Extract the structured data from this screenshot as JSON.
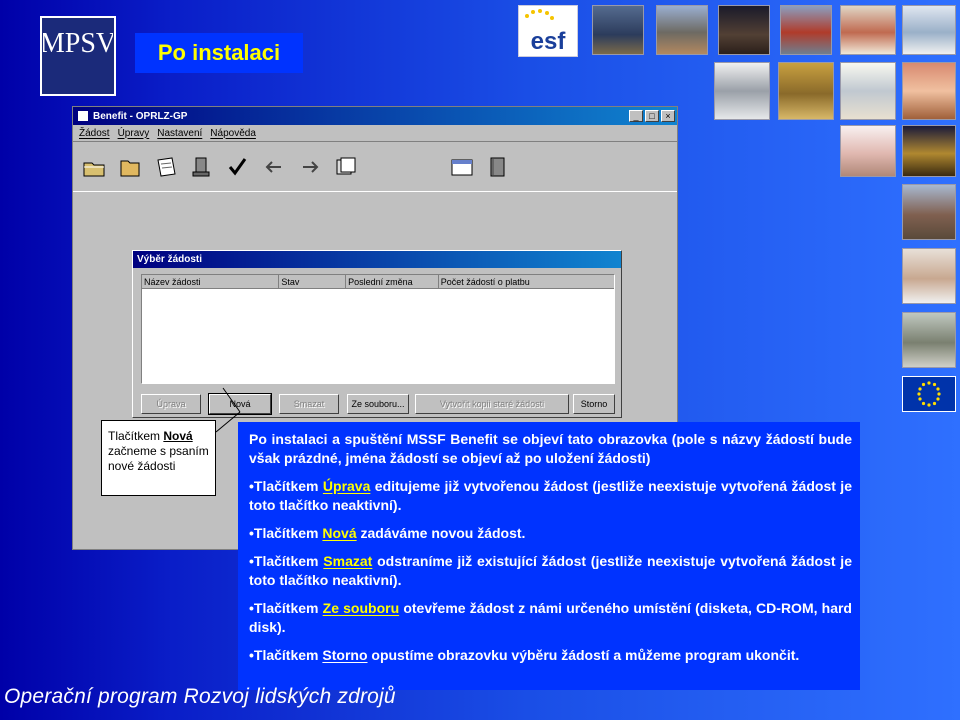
{
  "slide": {
    "title": "Po instalaci",
    "logo_text": "MPSV",
    "esf_text": "esf",
    "footer": "Operační program Rozvoj lidských zdrojů"
  },
  "colors": {
    "title_text": "#ffff00",
    "panel_bg": "#0033ff",
    "window_titlebar": "#000080"
  },
  "app": {
    "window_title": "Benefit - OPRLZ-GP",
    "menu": [
      "Žádost",
      "Úpravy",
      "Nastavení",
      "Nápověda"
    ],
    "toolbar_icons": [
      "folder-open-icon",
      "folder-icon",
      "document-icon",
      "stamp-icon",
      "check-icon",
      "arrow-left-icon",
      "arrow-right-icon",
      "cards-icon",
      "calendar-icon",
      "book-icon"
    ],
    "dialog": {
      "title": "Výběr žádosti",
      "columns": [
        "Název žádosti",
        "Stav",
        "Poslední změna",
        "Počet žádostí o platbu"
      ],
      "buttons": [
        {
          "label": "Úprava",
          "enabled": false
        },
        {
          "label": "Nová",
          "enabled": true
        },
        {
          "label": "Smazat",
          "enabled": false
        },
        {
          "label": "Ze souboru...",
          "enabled": true
        },
        {
          "label": "Vytvořit kopii staré žádosti",
          "enabled": false
        },
        {
          "label": "Storno",
          "enabled": true
        }
      ]
    }
  },
  "callout": {
    "prefix": "Tlačítkem ",
    "keyword": "Nová",
    "rest": " začneme s psaním nové žádosti"
  },
  "info": {
    "intro": "Po instalaci a spuštění MSSF Benefit se objeví tato obrazovka (pole s názvy žádostí bude však prázdné, jména žádostí se objeví až po uložení žádosti)",
    "items": [
      {
        "prefix": "•Tlačítkem ",
        "keyword": "Úprava",
        "text": " editujeme již vytvořenou žádost (jestliže neexistuje vytvořená žádost je toto tlačítko neaktivní)."
      },
      {
        "prefix": "•Tlačítkem ",
        "keyword": "Nová",
        "text": " zadáváme novou žádost."
      },
      {
        "prefix": "•Tlačítkem ",
        "keyword": "Smazat",
        "text": " odstraníme již existující žádost (jestliže neexistuje vytvořená žádost je toto tlačítko neaktivní)."
      },
      {
        "prefix": "•Tlačítkem ",
        "keyword": "Ze souboru",
        "text": " otevřeme žádost z námi určeného umístění (disketa, CD-ROM, hard disk)."
      },
      {
        "prefix": "•Tlačítkem ",
        "keyword": "Storno",
        "text": " opustíme obrazovku výběru žádostí a můžeme program ukončit."
      }
    ]
  }
}
